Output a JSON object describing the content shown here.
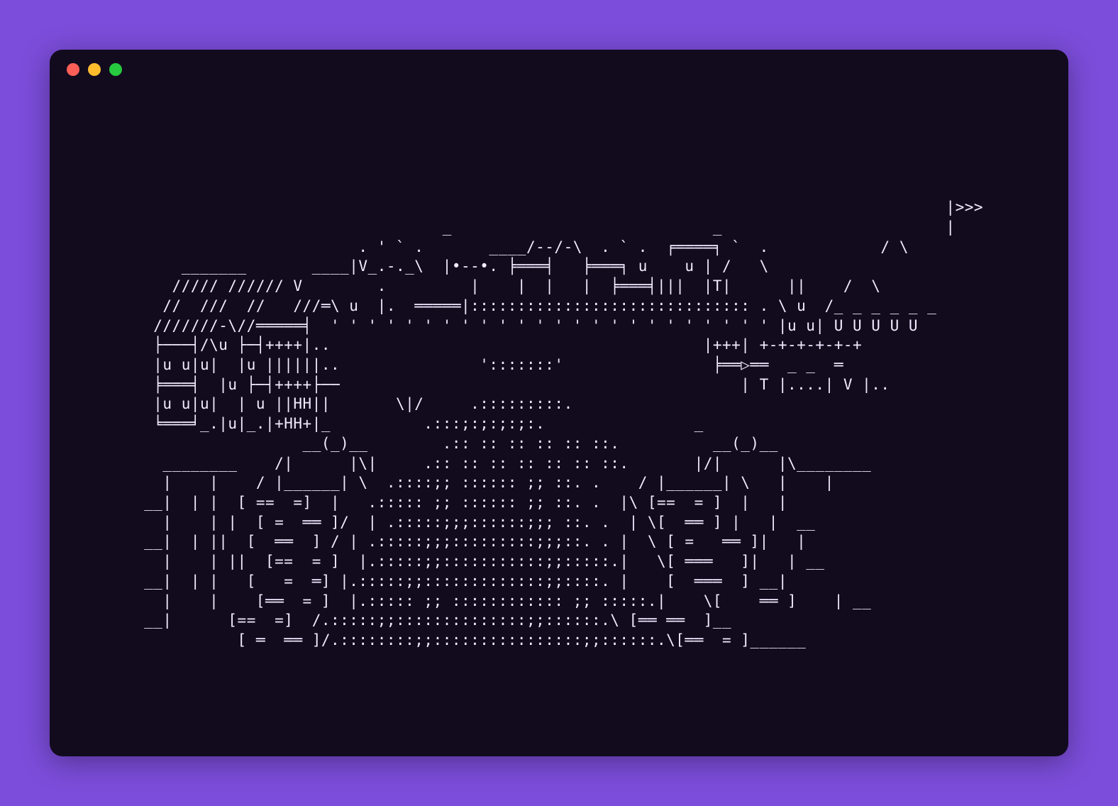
{
  "background_color": "#7c4dda",
  "terminal": {
    "background_color": "#120b1e",
    "text_color": "#f2eaff",
    "traffic_lights": {
      "close": {
        "color": "#ff5f56"
      },
      "minimize": {
        "color": "#ffbd2e"
      },
      "zoom": {
        "color": "#27c93f"
      }
    }
  },
  "ascii_art": {
    "description": "ASCII-art castle with towers, a flag '>>>', a bridge of colons, a wide road of dots/semicolons, and two brick gate pillars",
    "lines": [
      "                                                                                       |>>>",
      "                                 _                            _                        |",
      "                        . ' ` .       ____/--/-\\  . ` .  ╒════╕ `  .            / \\",
      "     _______       ____|V_.-._\\  |•--•. ╞═══╡   ╞═══╕ u    u | /   \\",
      "    ///// ////// V        .         |    |  |   |  ╞═══╡|||  |T|      ||    /  \\",
      "   //  ///  //   ///═\\ u  |.  ═════|:::::::::::::::::::::::::::::: . \\ u  /_ _ _ _ _ _",
      "  ///////-\\//═════╡  ' ' ' ' ' ' ' ' ' ' ' ' ' ' ' ' ' ' ' ' ' ' ' ' |u u| U U U U U",
      "  ├───┤/\\u ├─┤++++|..                                        |+++| +-+-+-+-+-+",
      "  |u u|u|  |u ||||||..               ':::::::'                ╞══▷══  _ _  ═",
      "  ╞═══╡  |u ├─┤++++├──                                           | T |....| V |..",
      "  |u u|u|  | u ||HH||       \\|/     .:::::::::.",
      "  ╘═══╛_.|u|_.|+HH+|_          .:::;:;:;:;:.                _",
      "                  __(_)__        .:: :: :: :: :: ::.          __(_)__",
      "   ________    /|      |\\|     .:: :: :: :: :: :: ::.       |/|      |\\________",
      "   |    |    / |______| \\  .::::;; :::::: ;; ::. .    / |______| \\   |    |",
      " __|  | |  [ ==  =]  |   .::::: ;; :::::: ;; ::. .  |\\ [==  = ]  |   |",
      "   |    | |  [ =  ══ ]/  | .:::::;;;::::::;;; ::. .  | \\[  ══ ] |   |  __",
      " __|  | ||  [  ══  ] / | .:::::;;;:::::::::;;;::. . |  \\ [ =   ══ ]|   |",
      "   |    | ||  [==  = ]  |.:::::;;:::::::::::;;:::::.|   \\[ ═══   ]|   | __",
      " __|  | |   [   =  ═] |.:::::;;:::::::::::::;;::::. |    [  ═══  ] __|",
      "   |    |    [══  = ]  |.::::: ;; :::::::::::: ;; :::::.|    \\[    ══ ]    | __",
      " __|      [==  =]  /.:::::;;::::::::::::::;;::::::.\\ [══ ══  ]__",
      "           [ ═  ══ ]/.::::::::;;::::::::::::::::;;::::::.\\[══  = ]______"
    ]
  }
}
